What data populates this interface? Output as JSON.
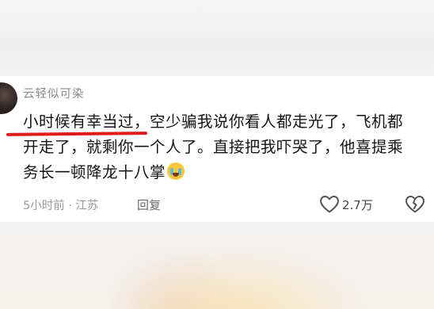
{
  "comment": {
    "username": "云轻似可染",
    "highlighted_text": "小时候有幸当过",
    "text_rest": "，空少骗我说你看人都走光了，飞机都开走了，就剩你一个人了。直接把我吓哭了，他喜提乘务长一顿降龙十八掌",
    "emoji_icon": "crying-laughing-emoji",
    "meta": "5小时前 · 江苏",
    "reply_label": "回复",
    "like_count": "2.7万",
    "highlight_color": "#e01b1b"
  }
}
